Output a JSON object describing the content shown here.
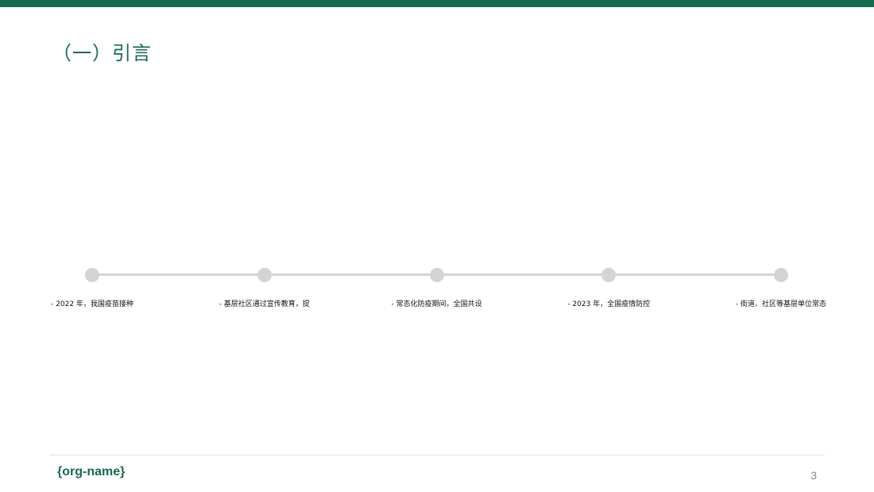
{
  "slide": {
    "title": "（一）引言",
    "accent_color": "#156b4e",
    "timeline_color": "#d4d4d4",
    "timeline": [
      {
        "label": "- 2022 年，我国疫苗接种"
      },
      {
        "label": "- 基层社区通过宣传教育，提"
      },
      {
        "label": "- 常态化防疫期间，全国共设"
      },
      {
        "label": "- 2023 年，全国疫情防控"
      },
      {
        "label": "- 街道、社区等基层单位常态"
      }
    ]
  },
  "footer": {
    "org_name": "{org-name}",
    "page_number": "3"
  }
}
